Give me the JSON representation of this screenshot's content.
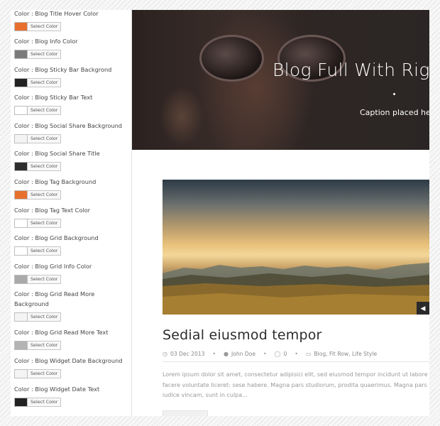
{
  "options": [
    {
      "label": "Color : Blog Title Hover Color",
      "swatch": "#e8702e",
      "button": "Select Color"
    },
    {
      "label": "Color : Blog Info Color",
      "swatch": "#7a7a7a",
      "button": "Select Color"
    },
    {
      "label": "Color : Blog Sticky Bar Backgrond",
      "swatch": "#222222",
      "button": "Select Color"
    },
    {
      "label": "Color : Blog Sticky Bar Text",
      "swatch": "#ffffff",
      "button": "Select Color"
    },
    {
      "label": "Color : Blog Social Share Background",
      "swatch": "#f4f4f4",
      "button": "Select Color"
    },
    {
      "label": "Color : Blog Social Share Title",
      "swatch": "#2e2e2e",
      "button": "Select Color"
    },
    {
      "label": "Color : Blog Tag Background",
      "swatch": "#e8702e",
      "button": "Select Color"
    },
    {
      "label": "Color : Blog Tag Text Color",
      "swatch": "#ffffff",
      "button": "Select Color"
    },
    {
      "label": "Color : Blog Grid Background",
      "swatch": "#ffffff",
      "button": "Select Color"
    },
    {
      "label": "Color : Blog Grid Info Color",
      "swatch": "#aaaaaa",
      "button": "Select Color"
    },
    {
      "label": "Color : Blog Grid Read More Background",
      "swatch": "#f4f4f4",
      "button": "Select Color"
    },
    {
      "label": "Color : Blog Grid Read More Text",
      "swatch": "#b4b4b4",
      "button": "Select Color"
    },
    {
      "label": "Color : Blog Widget Date Background",
      "swatch": "#f4f4f4",
      "button": "Select Color"
    },
    {
      "label": "Color : Blog Widget Date Text",
      "swatch": "#222222",
      "button": "Select Color"
    }
  ],
  "preview": {
    "hero_title": "Blog Full With Rig",
    "hero_caption": "Caption placed here",
    "post_title": "Sedial eiusmod tempor",
    "meta": {
      "date": "03 Dec 2013",
      "author": "John Doe",
      "comments": "0",
      "categories": "Blog, Fit Row, Life Style"
    },
    "excerpt": "Lorem ipsum dolor sit amet, consectetur adipisici elit, sed eiusmod tempor incidunt ut labore et dolore magna aliqua. Idque Caesaris facere voluntate liceret: sese habere. Magna pars studiorum, prodita quaerimus. Magna pars studiorum, prodita quaerimus. Fabio vel iudice vincam, sunt in culpa..."
  }
}
